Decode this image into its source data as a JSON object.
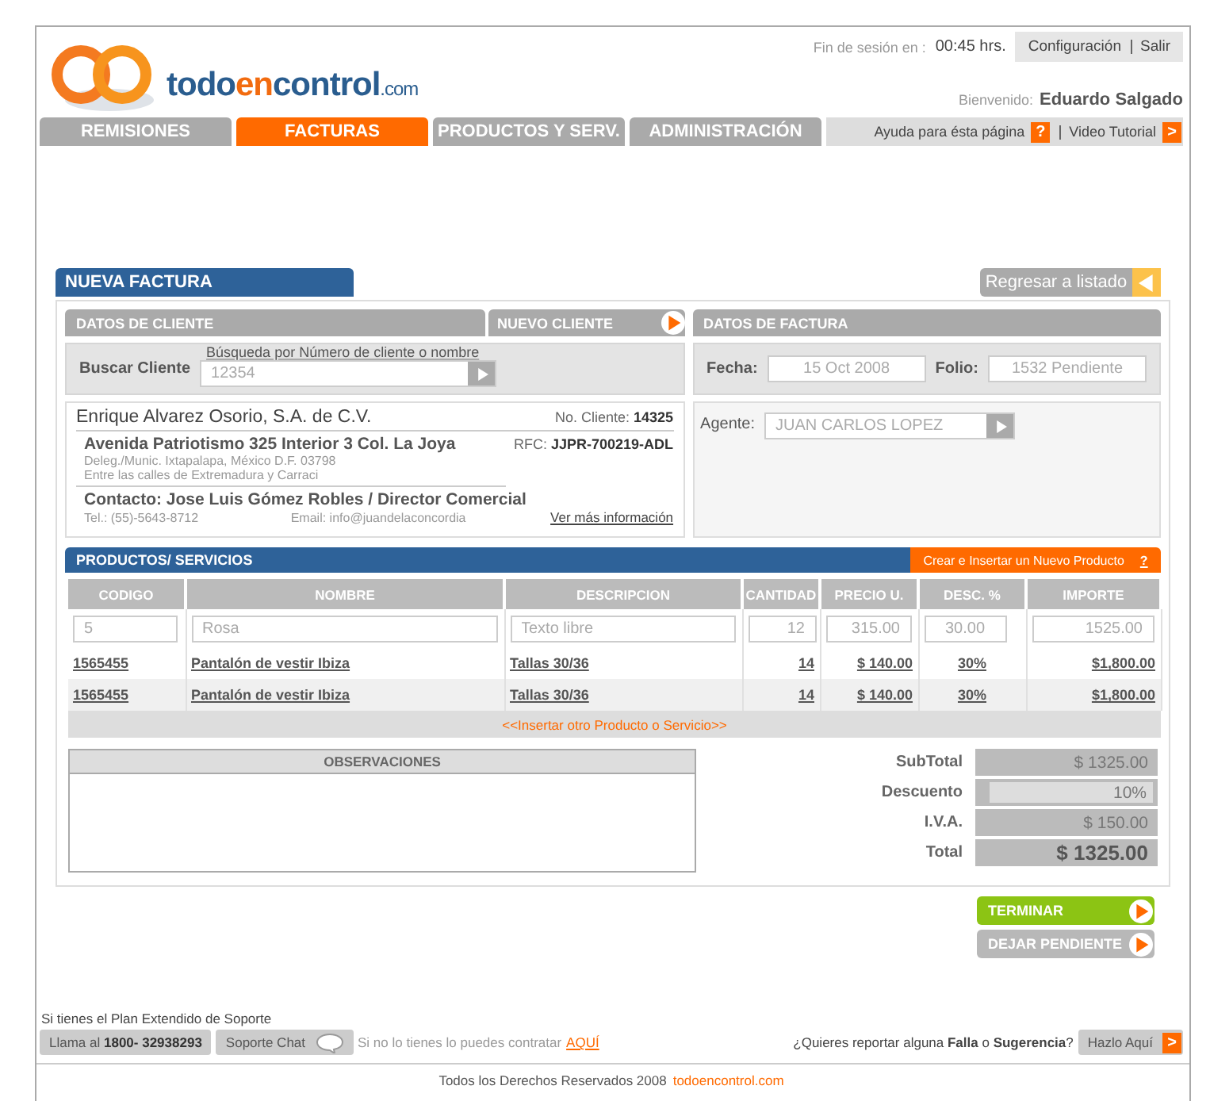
{
  "header": {
    "logo": {
      "parts": [
        "todo",
        "en",
        "control"
      ],
      "suffix": ".com"
    },
    "session_label": "Fin de sesión en :",
    "session_time": "00:45 hrs.",
    "links": [
      "Configuración",
      "Salir"
    ],
    "welcome_label": "Bienvenido:",
    "user": "Eduardo Salgado"
  },
  "nav": {
    "tabs": [
      {
        "label": "REMISIONES",
        "selected": false
      },
      {
        "label": "FACTURAS",
        "selected": true
      },
      {
        "label": "PRODUCTOS Y SERV.",
        "selected": false
      },
      {
        "label": "ADMINISTRACIÓN",
        "selected": false
      }
    ],
    "help": "Ayuda para ésta página",
    "help_icon": "?",
    "video": "Video Tutorial",
    "video_icon": ">"
  },
  "page_title": "NUEVA FACTURA",
  "back_button": "Regresar a listado",
  "client": {
    "section": "DATOS DE CLIENTE",
    "new_client": "NUEVO CLIENTE",
    "search_label": "Buscar Cliente",
    "search_hint": "Búsqueda por Número de cliente o nombre",
    "search_value": "12354",
    "name": "Enrique Alvarez Osorio, S.A. de C.V.",
    "number_label": "No. Cliente:",
    "number": "14325",
    "address": "Avenida Patriotismo 325 Interior 3 Col. La Joya",
    "rfc_label": "RFC:",
    "rfc": "JJPR-700219-ADL",
    "address_lines": [
      "Deleg./Munic.  Ixtapalapa, México D.F.  03798",
      "Entre las calles de Extremadura y Carraci"
    ],
    "contact_label": "Contacto:",
    "contact": "Jose Luis Gómez Robles / Director Comercial",
    "phone": "Tel.: (55)-5643-8712",
    "email": "Email: info@juandelaconcordia",
    "more": "Ver más información"
  },
  "invoice": {
    "section": "DATOS DE FACTURA",
    "date_label": "Fecha:",
    "date": "15 Oct 2008",
    "folio_label": "Folio:",
    "folio": "1532 Pendiente",
    "agent_label": "Agente:",
    "agent": "JUAN CARLOS LOPEZ"
  },
  "products": {
    "section": "PRODUCTOS/ SERVICIOS",
    "create": "Crear e Insertar  un Nuevo Producto",
    "create_icon": "?",
    "columns": [
      "CODIGO",
      "NOMBRE",
      "DESCRIPCION",
      "CANTIDAD",
      "PRECIO U.",
      "DESC. %",
      "IMPORTE"
    ],
    "entry": [
      {
        "value": "5"
      },
      {
        "value": "Rosa"
      },
      {
        "placeholder": "Texto libre"
      },
      {
        "value": "12"
      },
      {
        "value": "315.00"
      },
      {
        "value": "30.00"
      },
      {
        "value": "1525.00"
      }
    ],
    "rows": [
      [
        "1565455",
        "Pantalón de vestir Ibiza",
        "Tallas 30/36",
        "14",
        "$ 140.00",
        "30%",
        "$1,800.00"
      ],
      [
        "1565455",
        "Pantalón de vestir Ibiza",
        "Tallas 30/36",
        "14",
        "$ 140.00",
        "30%",
        "$1,800.00"
      ]
    ],
    "insert": "<<Insertar otro Producto o Servicio>>"
  },
  "observations": {
    "title": "OBSERVACIONES"
  },
  "totals": [
    {
      "label": "SubTotal",
      "value": "$ 1325.00",
      "kind": "plain"
    },
    {
      "label": "Descuento",
      "value": "10%",
      "kind": "input"
    },
    {
      "label": "I.V.A.",
      "value": "$ 150.00",
      "kind": "plain"
    },
    {
      "label": "Total",
      "value": "$ 1325.00",
      "kind": "grand"
    }
  ],
  "actions": [
    {
      "label": "TERMINAR",
      "kind": "primary"
    },
    {
      "label": "DEJAR PENDIENTE",
      "kind": "secondary"
    }
  ],
  "support": {
    "plan": "Si tienes el Plan Extendido de Soporte",
    "call": "Llama al  **1800- 32938293**",
    "chat": "Soporte Chat",
    "contract": "Si no lo tienes lo puedes contratar",
    "contract_link": "AQUÍ",
    "report": "¿Quieres reportar alguna **Falla** o **Sugerencia**?",
    "report_button": "Hazlo Aquí",
    "report_icon": ">"
  },
  "footer": {
    "copyright": "Todos los Derechos Reservados 2008",
    "link": "todoencontrol.com"
  }
}
